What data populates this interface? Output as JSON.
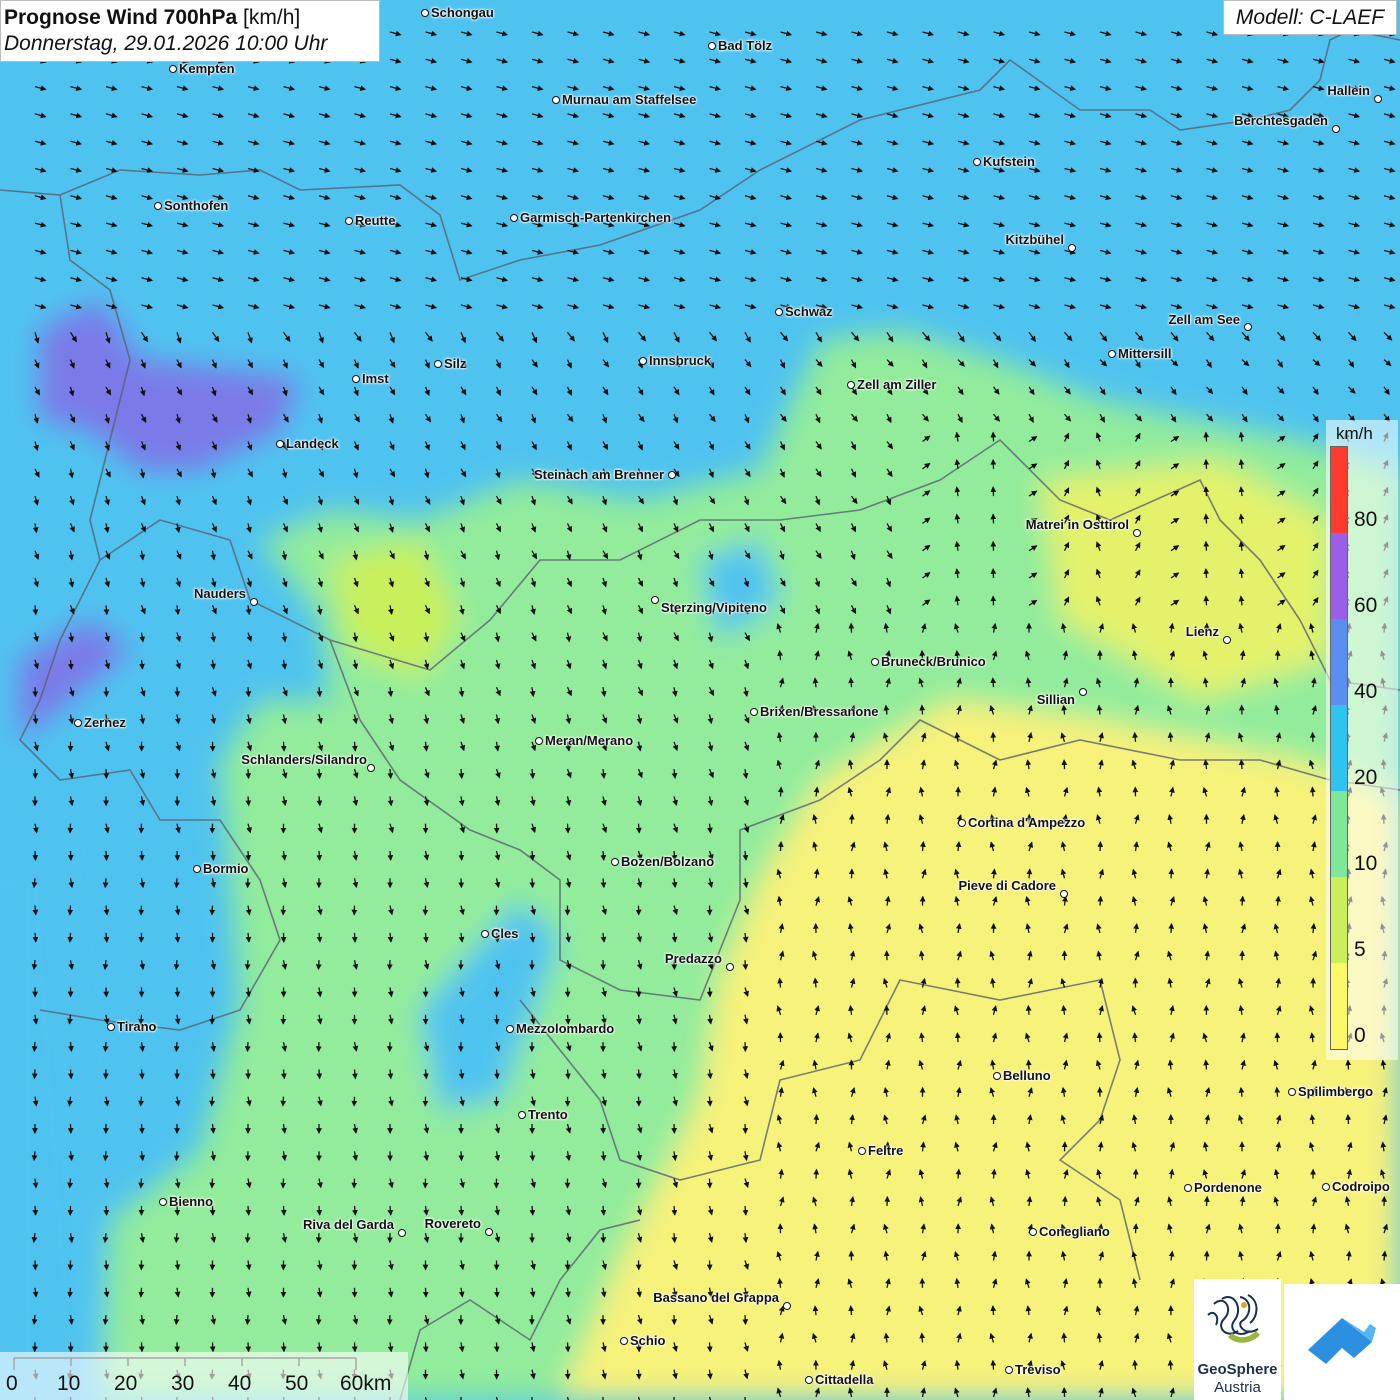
{
  "title": {
    "bold": "Prognose Wind 700hPa",
    "unit": "[km/h]",
    "datetime": "Donnerstag, 29.01.2026 10:00 Uhr"
  },
  "model": "Modell: C-LAEF",
  "legend": {
    "unit": "km/h",
    "ticks": [
      "80",
      "60",
      "40",
      "20",
      "10",
      "5",
      "0"
    ],
    "colors": [
      "#ff3b30",
      "#9a5ee8",
      "#5a8ef0",
      "#2fc4ef",
      "#7ee89a",
      "#c9f05a",
      "#fdf86a"
    ]
  },
  "scale": {
    "ticks": [
      "0",
      "10",
      "20",
      "30",
      "40",
      "50",
      "60km"
    ]
  },
  "logos": {
    "agency_line1": "GeoSphere",
    "agency_line2": "Austria",
    "agency_icon": "geosphere-logo-icon",
    "app_icon": "warning-app-icon"
  },
  "map_colors": {
    "north_blue": "#4fc3f0",
    "west_violet": "#7b79e8",
    "south_green": "#92ec9c",
    "southeast_yellow": "#f7f27a"
  },
  "cities": [
    {
      "name": "Schongau"
    },
    {
      "name": "Bad Tölz"
    },
    {
      "name": "Kempten"
    },
    {
      "name": "Murnau am Staffelsee"
    },
    {
      "name": "Hallein"
    },
    {
      "name": "Berchtesgaden"
    },
    {
      "name": "Kufstein"
    },
    {
      "name": "Sonthofen"
    },
    {
      "name": "Reutte"
    },
    {
      "name": "Garmisch-Partenkirchen"
    },
    {
      "name": "Kitzbühel"
    },
    {
      "name": "Schwaz"
    },
    {
      "name": "Zell am See"
    },
    {
      "name": "Mittersill"
    },
    {
      "name": "Innsbruck"
    },
    {
      "name": "Silz"
    },
    {
      "name": "Imst"
    },
    {
      "name": "Zell am Ziller"
    },
    {
      "name": "Landeck"
    },
    {
      "name": "Steinach am Brenner"
    },
    {
      "name": "Matrei in Osttirol"
    },
    {
      "name": "Nauders"
    },
    {
      "name": "Sterzing/Vipiteno"
    },
    {
      "name": "Lienz"
    },
    {
      "name": "Bruneck/Brunico"
    },
    {
      "name": "Sillian"
    },
    {
      "name": "Brixen/Bressanone"
    },
    {
      "name": "Zernez"
    },
    {
      "name": "Meran/Merano"
    },
    {
      "name": "Schlanders/Silandro"
    },
    {
      "name": "Cortina d'Ampezzo"
    },
    {
      "name": "Bozen/Bolzano"
    },
    {
      "name": "Bormio"
    },
    {
      "name": "Pieve di Cadore"
    },
    {
      "name": "Cles"
    },
    {
      "name": "Predazzo"
    },
    {
      "name": "Tirano"
    },
    {
      "name": "Mezzolombardo"
    },
    {
      "name": "Belluno"
    },
    {
      "name": "Spilimbergo"
    },
    {
      "name": "Trento"
    },
    {
      "name": "Feltre"
    },
    {
      "name": "Pordenone"
    },
    {
      "name": "Codroipo"
    },
    {
      "name": "Bienno"
    },
    {
      "name": "Riva del Garda"
    },
    {
      "name": "Rovereto"
    },
    {
      "name": "Conegliano"
    },
    {
      "name": "Bassano del Grappa"
    },
    {
      "name": "Schio"
    },
    {
      "name": "Treviso"
    },
    {
      "name": "Cittadella"
    }
  ]
}
